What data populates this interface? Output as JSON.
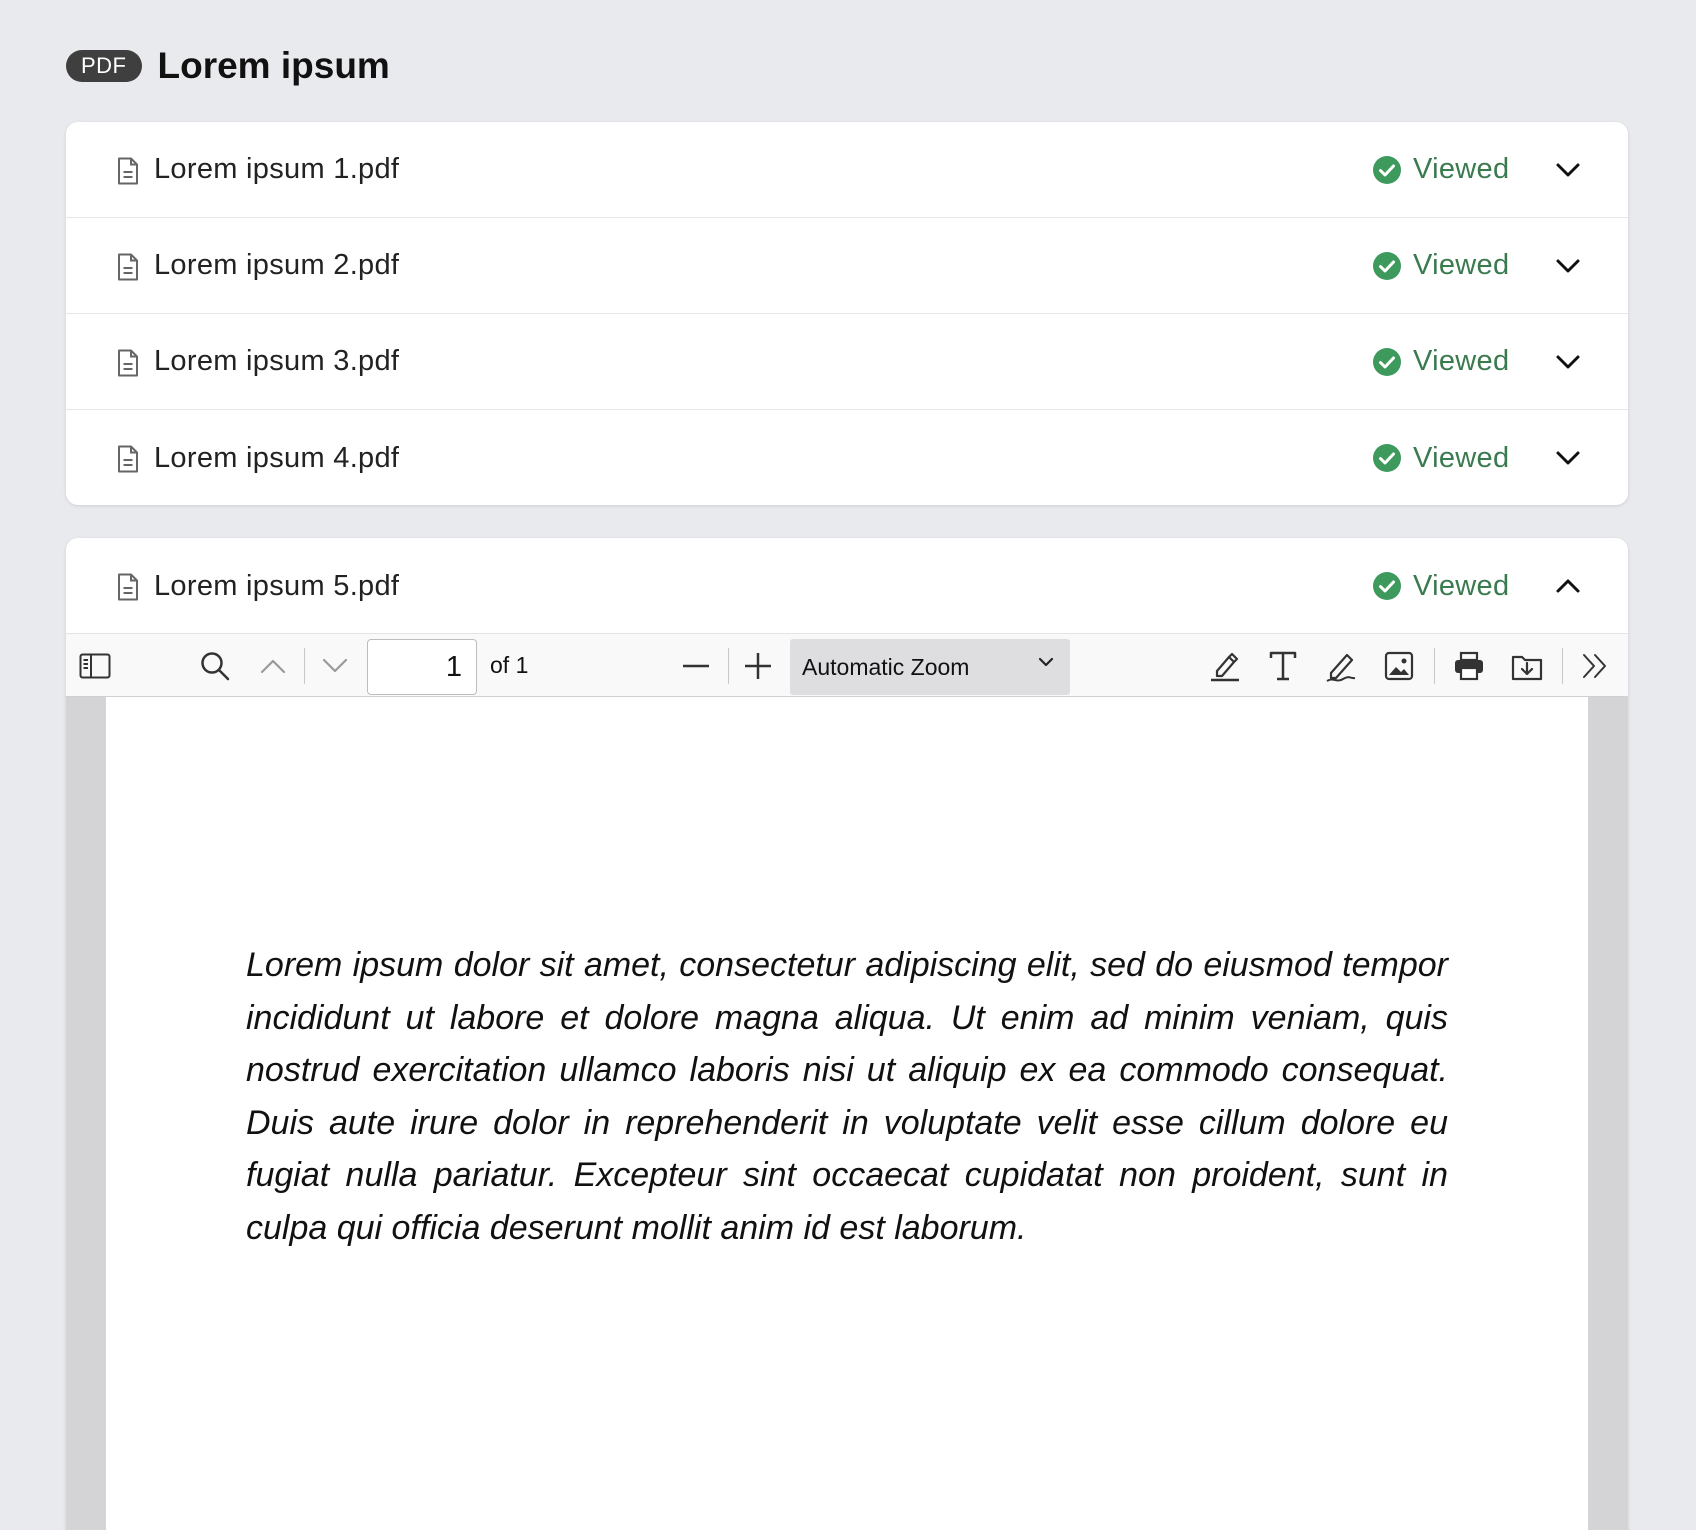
{
  "header": {
    "badge": "PDF",
    "title": "Lorem ipsum"
  },
  "files": [
    {
      "name": "Lorem ipsum 1.pdf",
      "status": "Viewed",
      "expanded": false
    },
    {
      "name": "Lorem ipsum 2.pdf",
      "status": "Viewed",
      "expanded": false
    },
    {
      "name": "Lorem ipsum 3.pdf",
      "status": "Viewed",
      "expanded": false
    },
    {
      "name": "Lorem ipsum 4.pdf",
      "status": "Viewed",
      "expanded": false
    },
    {
      "name": "Lorem ipsum 5.pdf",
      "status": "Viewed",
      "expanded": true
    }
  ],
  "viewer": {
    "toolbar": {
      "page_number": "1",
      "page_of": "of 1",
      "zoom": "Automatic Zoom",
      "icons": [
        "sidebar-toggle-icon",
        "search-icon",
        "previous-page-icon",
        "next-page-icon",
        "zoom-out-icon",
        "zoom-in-icon",
        "highlight-icon",
        "text-icon",
        "draw-icon",
        "image-icon",
        "print-icon",
        "download-icon",
        "more-tools-icon"
      ]
    },
    "document_text": "Lorem ipsum dolor sit amet, consectetur adipiscing elit, sed do eiusmod tempor incididunt ut labore et dolore magna aliqua. Ut enim ad minim veniam, quis nostrud exercitation ullamco laboris nisi ut aliquip ex ea commodo consequat. Duis aute irure dolor in reprehenderit in voluptate velit esse cillum dolore eu fugiat nulla pariatur. Excepteur sint occaecat cupidatat non proident, sunt in culpa qui officia deserunt mollit anim id est laborum."
  },
  "colors": {
    "background": "#e9eaee",
    "badge": "#3f3f3f",
    "viewed_green": "#3a7a4f",
    "check_green": "#3d9a5c"
  }
}
